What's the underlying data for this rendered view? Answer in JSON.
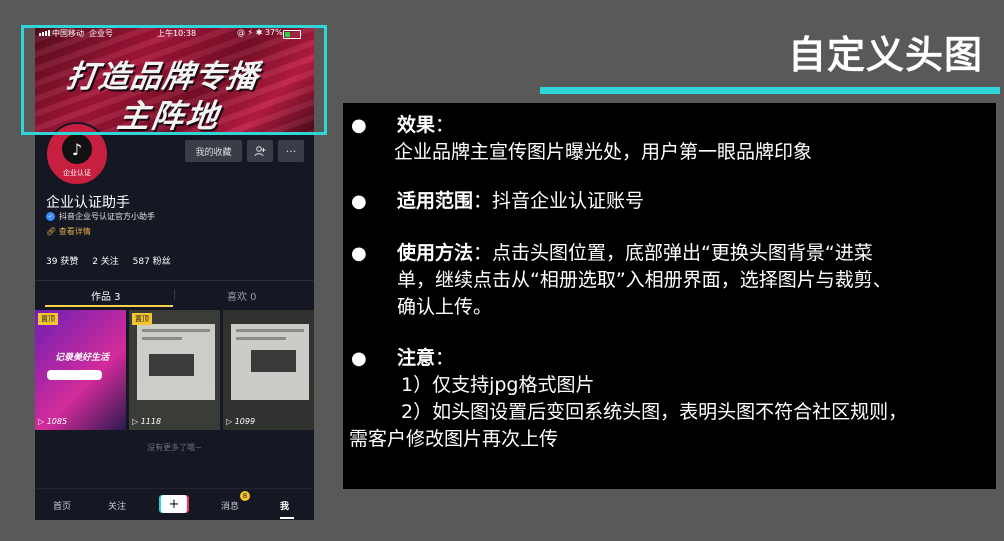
{
  "slide": {
    "title": "自定义头图",
    "colors": {
      "accent": "#2fd6d8",
      "panel_bg": "#000000",
      "slide_bg": "#595959"
    }
  },
  "phone": {
    "status_bar": {
      "carrier": "中国移动",
      "network": "企业号",
      "time": "上午10:38",
      "icons": "@ ⚡ ✱ 37%"
    },
    "banner": {
      "line1": "打造品牌专播",
      "line2": "主阵地"
    },
    "avatar_label": "企业认证",
    "buttons": {
      "favorites": "我的收藏",
      "add_friend_icon": "add-user-icon",
      "more": "···"
    },
    "profile": {
      "name": "企业认证助手",
      "verified_text": "抖音企业号认证官方小助手",
      "detail_link": "查看详情"
    },
    "stats": [
      {
        "label": "39 获赞"
      },
      {
        "label": "2 关注"
      },
      {
        "label": "587 粉丝"
      }
    ],
    "tabs": [
      {
        "label": "作品 3",
        "active": true
      },
      {
        "label": "喜欢 0",
        "active": false
      }
    ],
    "videos": [
      {
        "pin": "置顶",
        "views": "1085",
        "caption": "记录美好生活"
      },
      {
        "pin": "置顶",
        "views": "1118"
      },
      {
        "views": "1099"
      }
    ],
    "no_more": "没有更多了哦~",
    "nav": {
      "home": "首页",
      "follow": "关注",
      "plus": "+",
      "messages": "消息",
      "messages_badge": "8",
      "me": "我"
    }
  },
  "panel": {
    "effect": {
      "label": "效果",
      "sep": "：",
      "text": "企业品牌主宣传图片曝光处，用户第一眼品牌印象"
    },
    "scope": {
      "label": "适用范围",
      "text": "：抖音企业认证账号"
    },
    "usage": {
      "label": "使用方法",
      "text1": "：点击头图位置，底部弹出“更换头图背景“进菜",
      "text2": "单，继续点击从“相册选取”入相册界面，选择图片与裁剪、",
      "text3": "确认上传。"
    },
    "notice": {
      "label": "注意",
      "sep": "：",
      "item1": "1）仅支持jpg格式图片",
      "item2": "2）如头图设置后变回系统头图，表明头图不符合社区规则，",
      "item2_cont": "需客户修改图片再次上传"
    },
    "bullet": "●"
  }
}
